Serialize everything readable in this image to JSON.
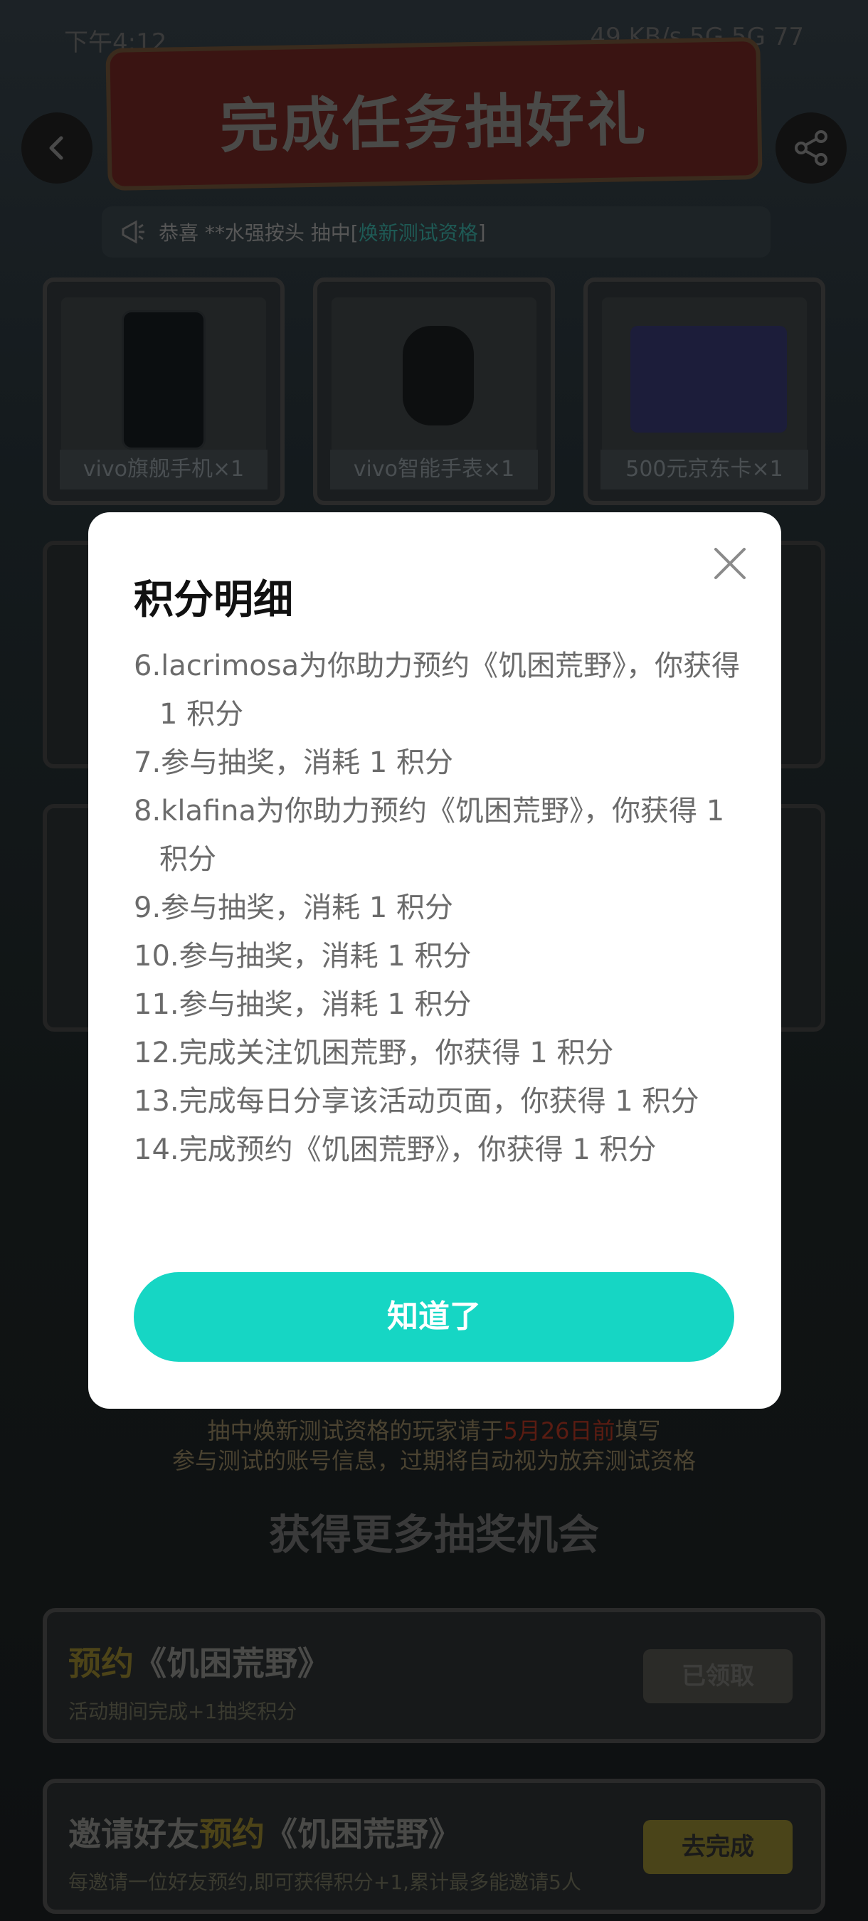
{
  "status": {
    "left": "下午4:12",
    "right": "49 KB/s  5G  5G  77"
  },
  "header": {
    "banner_title": "完成任务抽好礼"
  },
  "ticker": {
    "prefix": "恭喜 **水强按头 抽中[ ",
    "prize": "焕新测试资格",
    "suffix": " ]"
  },
  "prizes": [
    {
      "label": "vivo旗舰手机×1"
    },
    {
      "label": "vivo智能手表×1"
    },
    {
      "label": "500元京东卡×1"
    }
  ],
  "notice": {
    "line1_a": "抽中焕新测试资格的玩家请于",
    "line1_date": "5月26日前",
    "line1_b": "填写",
    "line2": "参与测试的账号信息，过期将自动视为放弃测试资格"
  },
  "section_title": "获得更多抽奖机会",
  "tasks": [
    {
      "title_a": "预约",
      "title_b": "《饥困荒野》",
      "sub": "活动期间完成+1抽奖积分",
      "btn": "已领取"
    },
    {
      "title_a": "邀请好友",
      "title_y": "预约",
      "title_b": "《饥困荒野》",
      "sub": "每邀请一位好友预约,即可获得积分+1,累计最多能邀请5人",
      "btn": "去完成"
    }
  ],
  "modal": {
    "title": "积分明细",
    "records": [
      "6.lacrimosa为你助力预约《饥困荒野》，你获得 1 积分",
      "7.参与抽奖，消耗 1 积分",
      "8.klafina为你助力预约《饥困荒野》，你获得 1 积分",
      "9.参与抽奖，消耗 1 积分",
      "10.参与抽奖，消耗 1 积分",
      "11.参与抽奖，消耗 1 积分",
      "12.完成关注饥困荒野，你获得 1 积分",
      "13.完成每日分享该活动页面，你获得 1 积分",
      "14.完成预约《饥困荒野》，你获得 1 积分"
    ],
    "ok_label": "知道了"
  },
  "colors": {
    "accent": "#16d6c4",
    "modal_bg": "#ffffff",
    "record_text": "#6b6b6b"
  }
}
